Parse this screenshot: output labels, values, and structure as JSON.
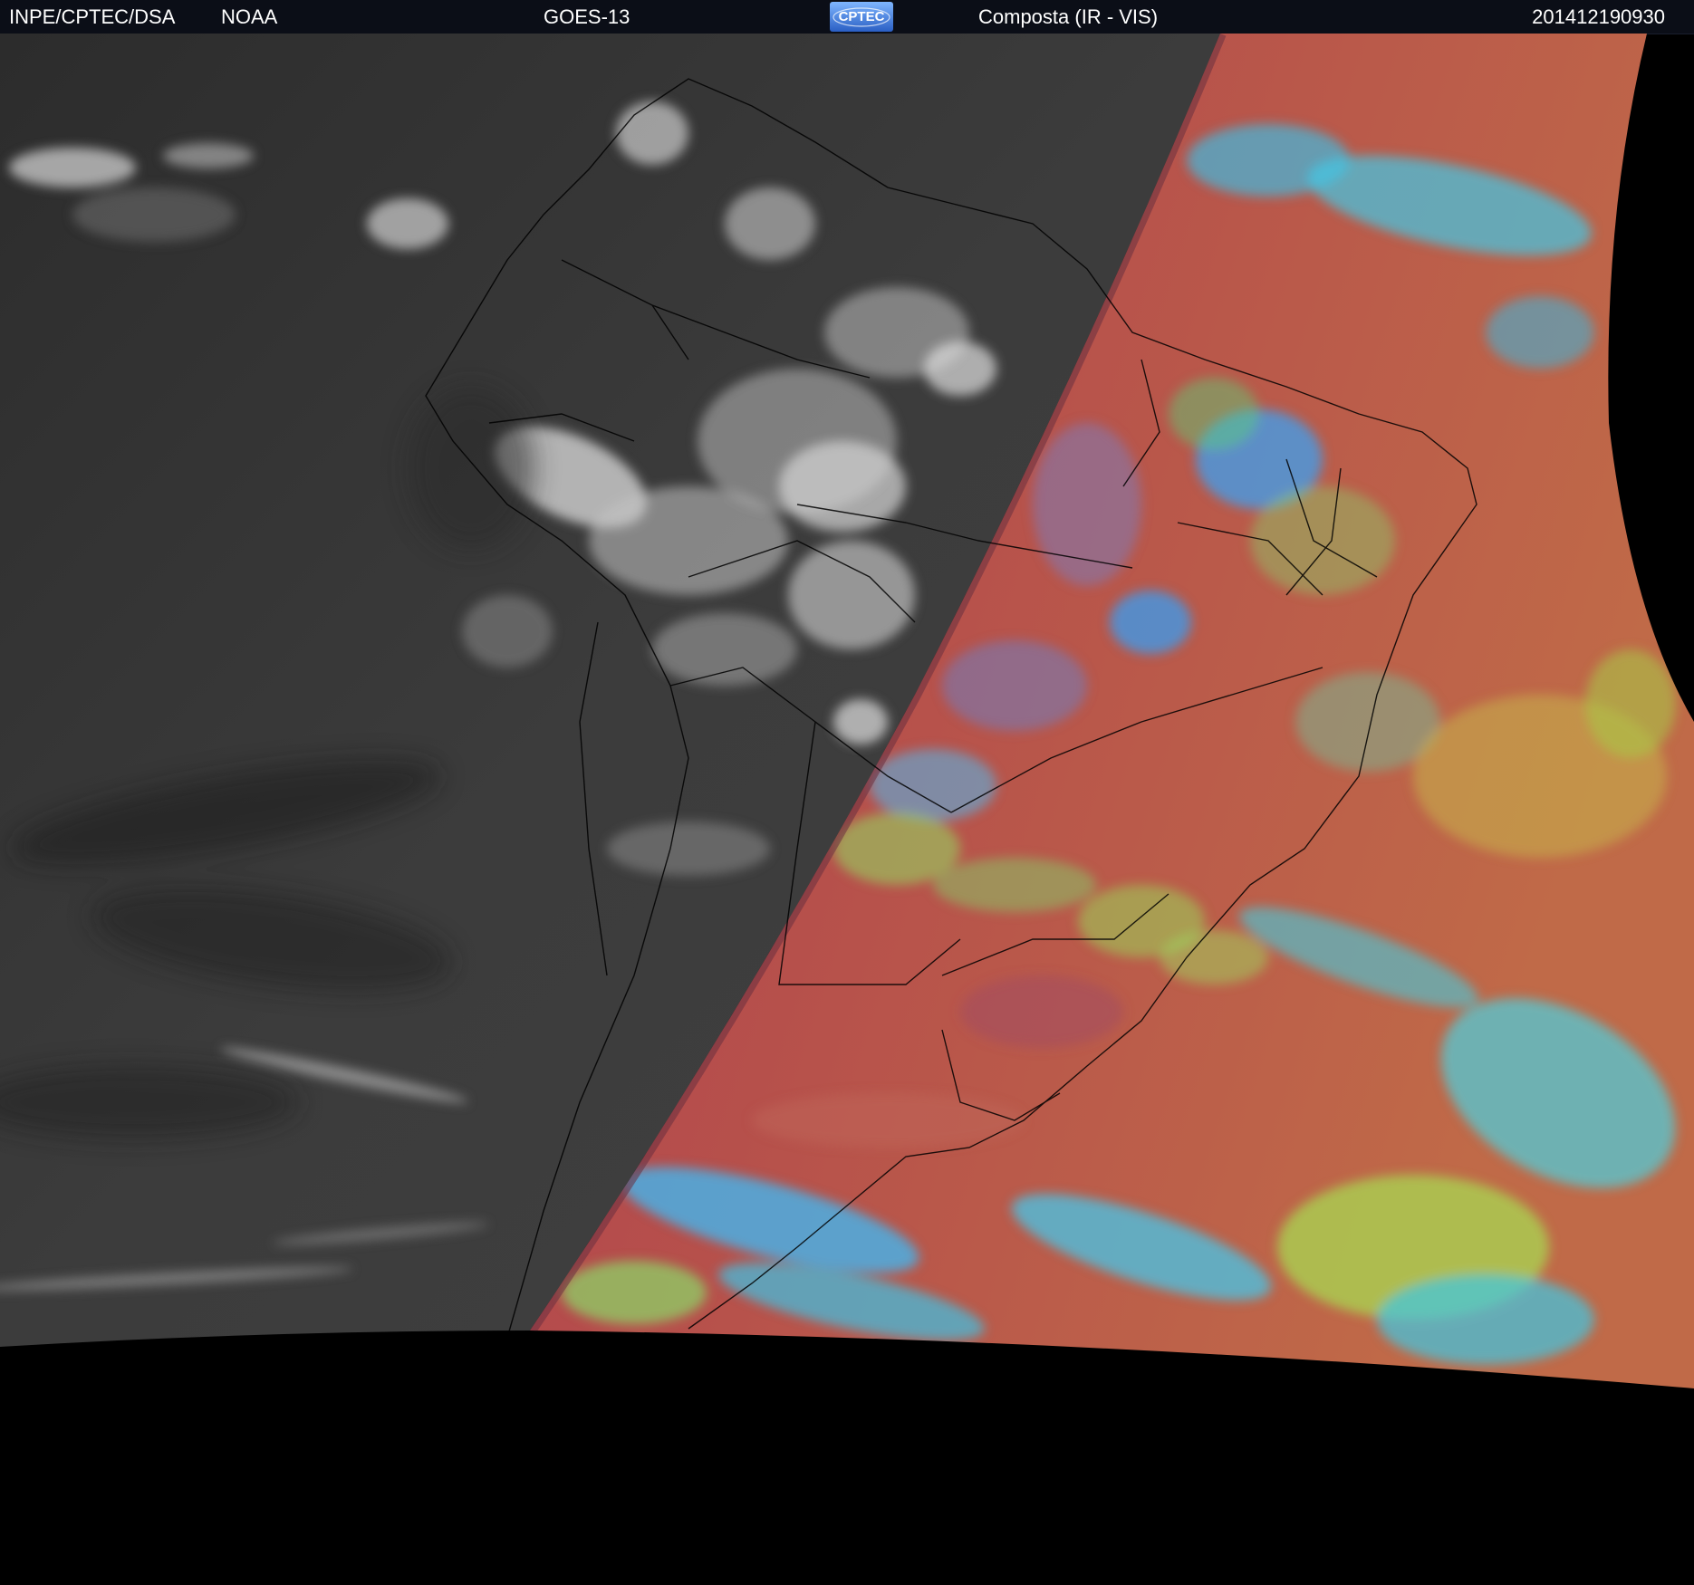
{
  "header": {
    "organization": "INPE/CPTEC/DSA",
    "agency": "NOAA",
    "satellite": "GOES-13",
    "logo_text": "CPTEC",
    "product": "Composta (IR - VIS)",
    "timestamp": "201412190930"
  },
  "colors": {
    "header_bg": "#0b0e17",
    "space_bg": "#000000",
    "ir_night_gray": "#3a3a3a",
    "vis_ocean_red": "#b0484e",
    "cloud_cyan": "#3cc8e8",
    "cloud_green": "#8cd850",
    "borders": "#000000"
  },
  "icons": {
    "logo": "cptec-logo"
  }
}
